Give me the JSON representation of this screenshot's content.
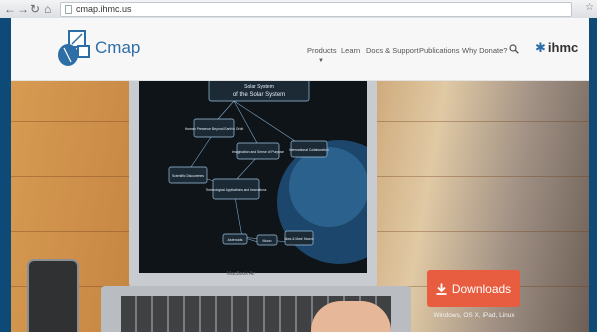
{
  "browser": {
    "url": "cmap.ihmc.us"
  },
  "header": {
    "logo_text": "Cmap",
    "nav": [
      "Products",
      "Learn",
      "Docs & Support",
      "Publications",
      "Why Donate?"
    ],
    "org_logo": "ihmc"
  },
  "hero": {
    "map_title": "Solar System",
    "map_subtitle": "of the Solar System",
    "nodes": [
      "Human Presence Beyond Earth's Orbit",
      "International Collaboration",
      "Imagination and Sense of Purpose",
      "Scientific Discoveries",
      "Technological Applications and Innovations",
      "Asteroids",
      "Moon",
      "Mars & Mars' Moons"
    ],
    "laptop_label": "MacBook Air",
    "downloads_label": "Downloads",
    "platforms": "Windows, OS X, iPad, Linux"
  },
  "colors": {
    "frame": "#0d4a78",
    "brand_blue": "#2e6ea6",
    "download_button": "#e85d3f"
  },
  "icons": {
    "back": "back-arrow-icon",
    "forward": "forward-arrow-icon",
    "reload": "reload-icon",
    "home": "home-icon",
    "search": "search-icon",
    "download": "download-icon"
  }
}
